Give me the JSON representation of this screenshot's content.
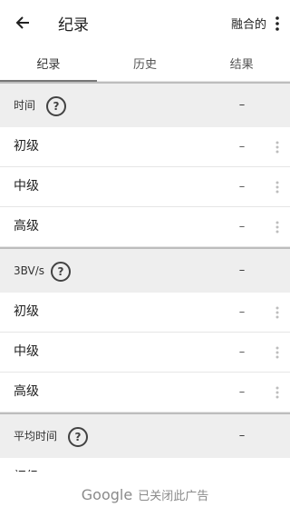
{
  "header": {
    "title": "纪录",
    "board_label": "融合的"
  },
  "tabs": [
    {
      "label": "纪录"
    },
    {
      "label": "历史"
    },
    {
      "label": "结果"
    }
  ],
  "sections": [
    {
      "label": "时间",
      "help_symbol": "?",
      "value": "–",
      "rows": [
        {
          "label": "初级",
          "value": "–"
        },
        {
          "label": "中级",
          "value": "–"
        },
        {
          "label": "高级",
          "value": "–"
        }
      ]
    },
    {
      "label": "3BV/s",
      "help_symbol": "?",
      "value": "–",
      "rows": [
        {
          "label": "初级",
          "value": "–"
        },
        {
          "label": "中级",
          "value": "–"
        },
        {
          "label": "高级",
          "value": "–"
        }
      ]
    },
    {
      "label": "平均时间",
      "help_symbol": "?",
      "value": "–",
      "rows": [
        {
          "label": "初级",
          "value": "–"
        }
      ]
    }
  ],
  "ad": {
    "brand": "Google",
    "text": "已关闭此广告"
  }
}
